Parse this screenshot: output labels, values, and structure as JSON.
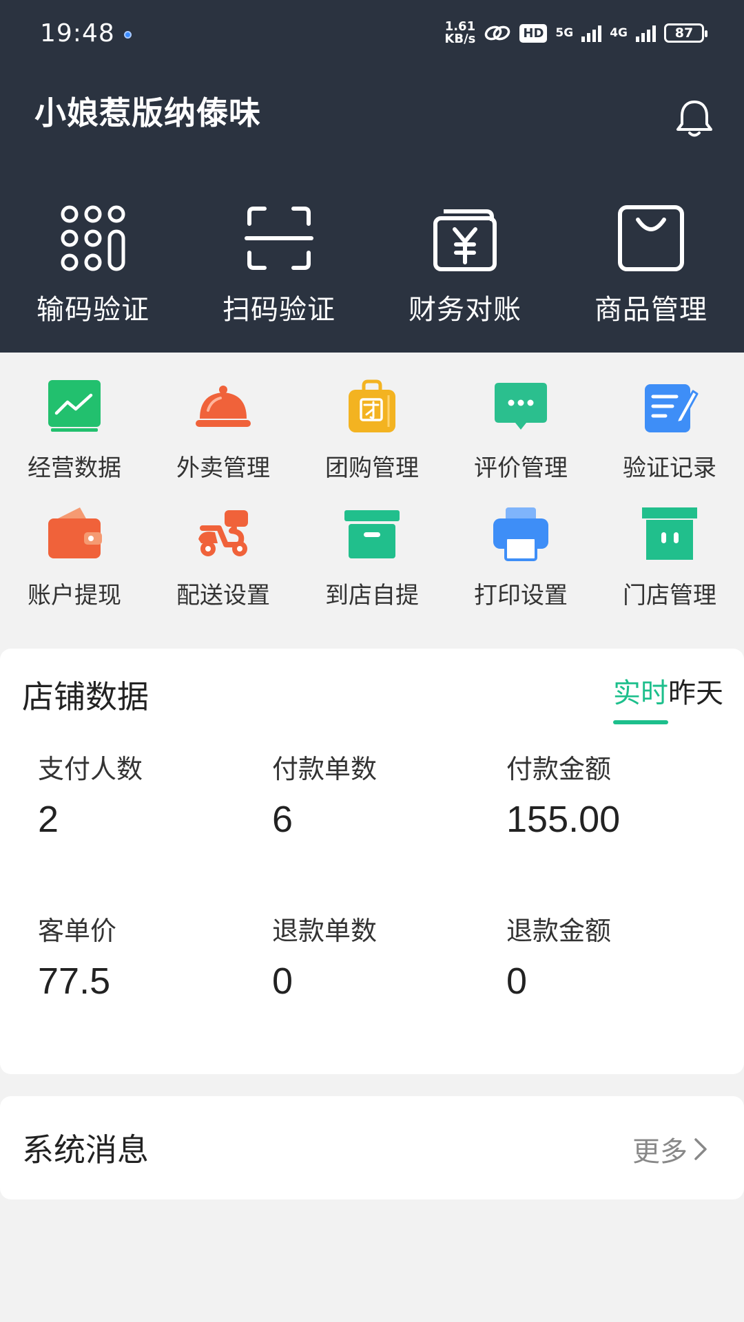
{
  "status_bar": {
    "time": "19:48",
    "speed_value": "1.61",
    "speed_unit": "KB/s",
    "hd": "HD",
    "net1": "5G",
    "net2": "4G",
    "battery": "87"
  },
  "header": {
    "store_name": "小娘惹版纳傣味",
    "bell_icon": "bell-icon"
  },
  "top_actions": [
    {
      "label": "输码验证",
      "icon": "keypad-icon"
    },
    {
      "label": "扫码验证",
      "icon": "scan-icon"
    },
    {
      "label": "财务对账",
      "icon": "yuan-wallet-icon"
    },
    {
      "label": "商品管理",
      "icon": "shopping-bag-icon"
    }
  ],
  "grid": [
    {
      "label": "经营数据",
      "icon": "chart-icon",
      "color": "#22c06e"
    },
    {
      "label": "外卖管理",
      "icon": "cloche-icon",
      "color": "#f0623a"
    },
    {
      "label": "团购管理",
      "icon": "group-buy-icon",
      "color": "#f3b321"
    },
    {
      "label": "评价管理",
      "icon": "comment-icon",
      "color": "#2bbf8e"
    },
    {
      "label": "验证记录",
      "icon": "edit-doc-icon",
      "color": "#3e8ef7"
    },
    {
      "label": "账户提现",
      "icon": "wallet-icon",
      "color": "#f0623a"
    },
    {
      "label": "配送设置",
      "icon": "scooter-icon",
      "color": "#f0623a"
    },
    {
      "label": "到店自提",
      "icon": "box-icon",
      "color": "#21bf8c"
    },
    {
      "label": "打印设置",
      "icon": "printer-icon",
      "color": "#3e8ef7"
    },
    {
      "label": "门店管理",
      "icon": "store-icon",
      "color": "#21bf8c"
    }
  ],
  "store_data": {
    "title": "店铺数据",
    "tab_active": "实时",
    "tab_inactive": "昨天",
    "metrics": [
      {
        "label": "支付人数",
        "value": "2"
      },
      {
        "label": "付款单数",
        "value": "6"
      },
      {
        "label": "付款金额",
        "value": "155.00"
      },
      {
        "label": "客单价",
        "value": "77.5"
      },
      {
        "label": "退款单数",
        "value": "0"
      },
      {
        "label": "退款金额",
        "value": "0"
      }
    ]
  },
  "messages": {
    "title": "系统消息",
    "more": "更多"
  },
  "colors": {
    "header_bg": "#2b3340",
    "accent": "#1dbf8c"
  }
}
